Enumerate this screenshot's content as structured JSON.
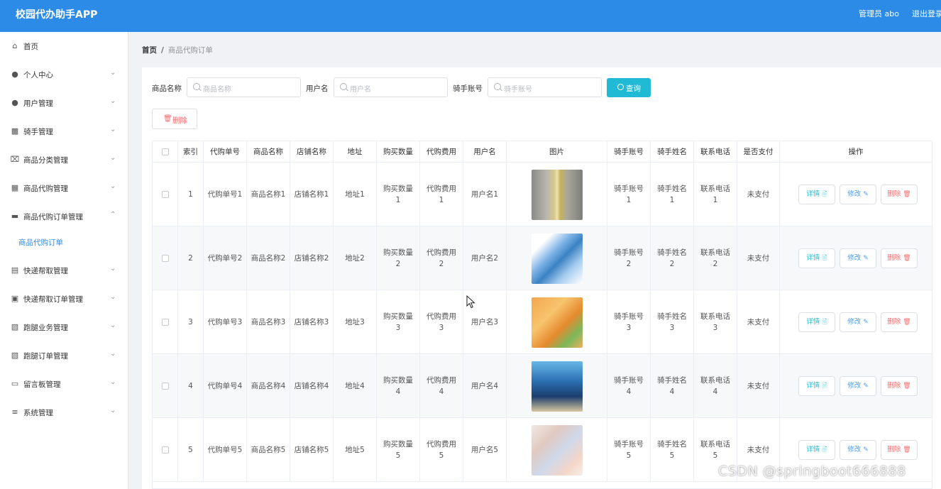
{
  "header": {
    "app_title": "校园代办助手APP",
    "admin_label": "管理员 abo",
    "logout_label": "退出登录"
  },
  "sidebar": {
    "items": [
      {
        "label": "首页",
        "icon": "home-icon",
        "has_arrow": false
      },
      {
        "label": "个人中心",
        "icon": "user-icon",
        "has_arrow": true
      },
      {
        "label": "用户管理",
        "icon": "user-icon",
        "has_arrow": true
      },
      {
        "label": "骑手管理",
        "icon": "monitor-icon",
        "has_arrow": true
      },
      {
        "label": "商品分类管理",
        "icon": "crop-icon",
        "has_arrow": true
      },
      {
        "label": "商品代购管理",
        "icon": "grid-icon",
        "has_arrow": true
      },
      {
        "label": "商品代购订单管理",
        "icon": "chat-icon",
        "has_arrow": true,
        "expanded": true
      },
      {
        "label": "快递帮取管理",
        "icon": "chart-icon",
        "has_arrow": true
      },
      {
        "label": "快递帮取订单管理",
        "icon": "picture-icon",
        "has_arrow": true
      },
      {
        "label": "跑腿业务管理",
        "icon": "clipboard-icon",
        "has_arrow": true
      },
      {
        "label": "跑腿订单管理",
        "icon": "clipboard-icon",
        "has_arrow": true
      },
      {
        "label": "留言板管理",
        "icon": "ticket-icon",
        "has_arrow": true
      },
      {
        "label": "系统管理",
        "icon": "sliders-icon",
        "has_arrow": true
      }
    ],
    "active_subitem": "商品代购订单"
  },
  "breadcrumb": {
    "home": "首页",
    "separator": "/",
    "current": "商品代购订单"
  },
  "search": {
    "product_label": "商品名称",
    "product_placeholder": "商品名称",
    "user_label": "用户名",
    "user_placeholder": "用户名",
    "rider_label": "骑手账号",
    "rider_placeholder": "骑手账号",
    "query_label": "查询"
  },
  "toolbar": {
    "delete_label": "删除"
  },
  "table": {
    "headers": [
      "索引",
      "代购单号",
      "商品名称",
      "店铺名称",
      "地址",
      "购买数量",
      "代购费用",
      "用户名",
      "图片",
      "骑手账号",
      "骑手姓名",
      "联系电话",
      "是否支付",
      "操作"
    ],
    "rows": [
      {
        "index": "1",
        "order_no": "代购单号1",
        "product": "商品名称1",
        "shop": "店铺名称1",
        "address": "地址1",
        "qty": "购买数量1",
        "fee": "代购费用1",
        "user": "用户名1",
        "rider_account": "骑手账号1",
        "rider_name": "骑手姓名1",
        "phone": "联系电话1",
        "paid": "未支付",
        "image": "liquor-bottle"
      },
      {
        "index": "2",
        "order_no": "代购单号2",
        "product": "商品名称2",
        "shop": "店铺名称2",
        "address": "地址2",
        "qty": "购买数量2",
        "fee": "代购费用2",
        "user": "用户名2",
        "rider_account": "骑手账号2",
        "rider_name": "骑手姓名2",
        "phone": "联系电话2",
        "paid": "未支付",
        "image": "water-jug"
      },
      {
        "index": "3",
        "order_no": "代购单号3",
        "product": "商品名称3",
        "shop": "店铺名称3",
        "address": "地址3",
        "qty": "购买数量3",
        "fee": "代购费用3",
        "user": "用户名3",
        "rider_account": "骑手账号3",
        "rider_name": "骑手姓名3",
        "phone": "联系电话3",
        "paid": "未支付",
        "image": "kitchen-tools"
      },
      {
        "index": "4",
        "order_no": "代购单号4",
        "product": "商品名称4",
        "shop": "店铺名称4",
        "address": "地址4",
        "qty": "购买数量4",
        "fee": "代购费用4",
        "user": "用户名4",
        "rider_account": "骑手账号4",
        "rider_name": "骑手姓名4",
        "phone": "联系电话4",
        "paid": "未支付",
        "image": "tote-bag"
      },
      {
        "index": "5",
        "order_no": "代购单号5",
        "product": "商品名称5",
        "shop": "店铺名称5",
        "address": "地址5",
        "qty": "购买数量5",
        "fee": "代购费用5",
        "user": "用户名5",
        "rider_account": "骑手账号5",
        "rider_name": "骑手姓名5",
        "phone": "联系电话5",
        "paid": "未支付",
        "image": "hangers"
      }
    ],
    "actions": {
      "detail": "详情",
      "edit": "修改",
      "delete": "删除"
    }
  },
  "watermark": "CSDN @springboot666888",
  "colors": {
    "topbar": "#2d8be8",
    "query_button": "#21bad4",
    "danger": "#f56c6c",
    "active_menu": "#2d8be8"
  }
}
